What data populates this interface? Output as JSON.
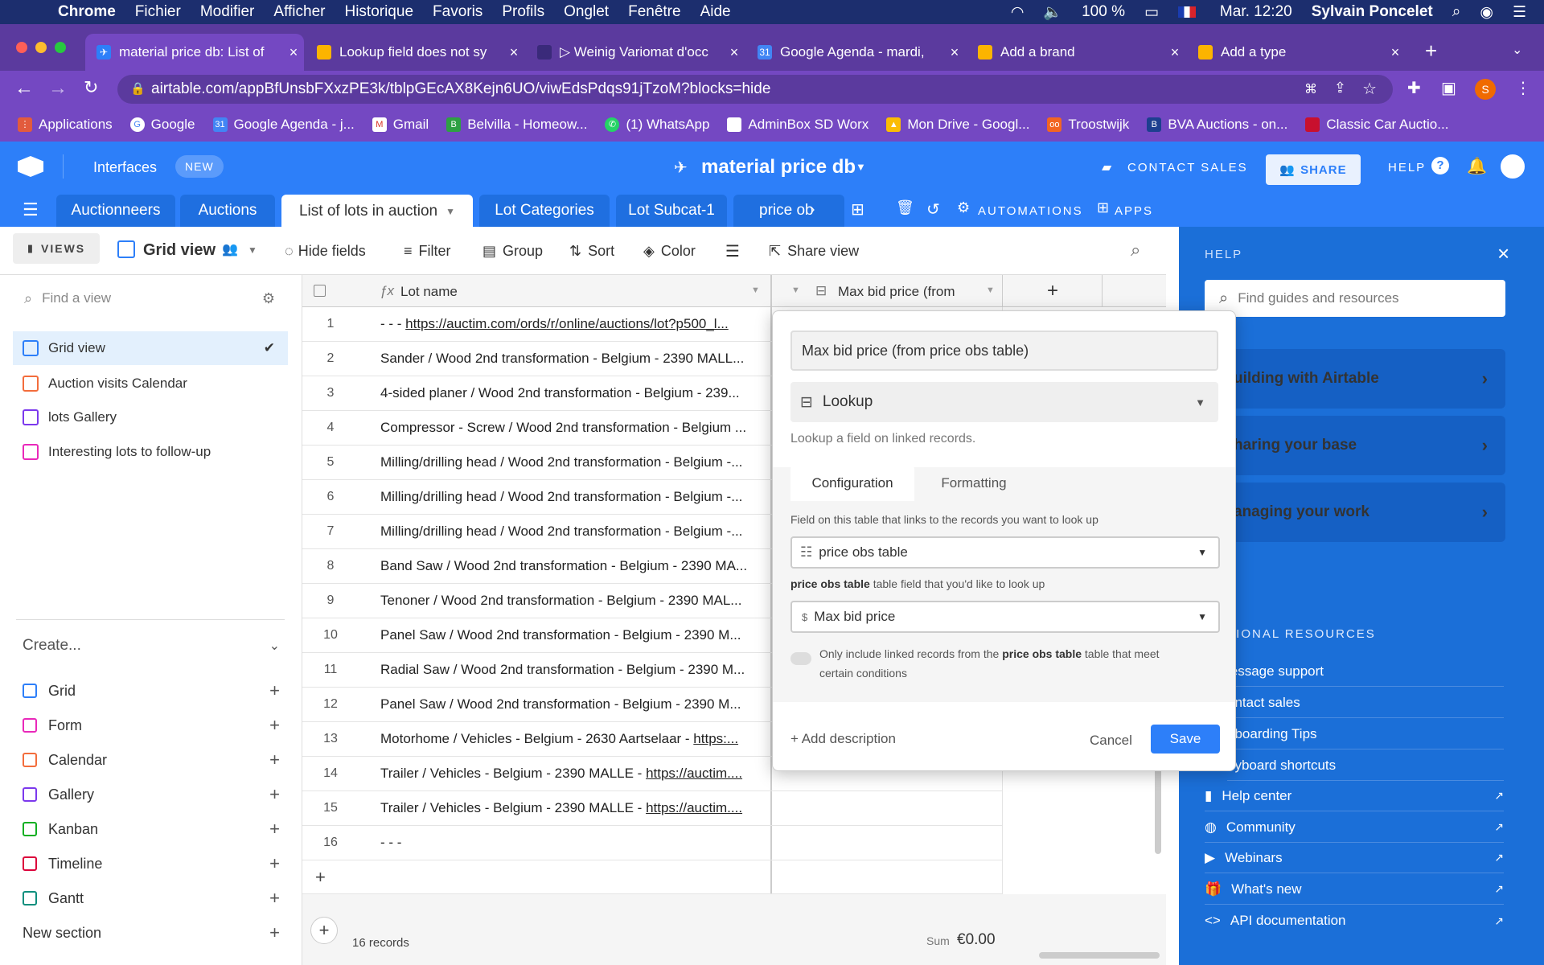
{
  "menubar": {
    "app": "Chrome",
    "items": [
      "Fichier",
      "Modifier",
      "Afficher",
      "Historique",
      "Favoris",
      "Profils",
      "Onglet",
      "Fenêtre",
      "Aide"
    ],
    "battery": "100 %",
    "datetime": "Mar. 12:20",
    "user": "Sylvain Poncelet"
  },
  "browser_tabs": [
    {
      "label": "material price db: List of",
      "active": true
    },
    {
      "label": "Lookup field does not sy"
    },
    {
      "label": "▷ Weinig Variomat d'occ"
    },
    {
      "label": "Google Agenda - mardi,"
    },
    {
      "label": "Add a brand"
    },
    {
      "label": "Add a type"
    }
  ],
  "url": "airtable.com/appBfUnsbFXxzPE3k/tblpGEcAX8Kejn6UO/viwEdsPdqs91jTzoM?blocks=hide",
  "bookmarks": [
    "Applications",
    "Google",
    "Google Agenda - j...",
    "Gmail",
    "Belvilla - Homeow...",
    "(1) WhatsApp",
    "AdminBox SD Worx",
    "Mon Drive - Googl...",
    "Troostwijk",
    "BVA Auctions - on...",
    "Classic Car Auctio..."
  ],
  "app_header": {
    "interfaces": "Interfaces",
    "new_badge": "NEW",
    "base_name": "material price db",
    "contact_sales": "CONTACT SALES",
    "share": "SHARE",
    "help": "HELP"
  },
  "table_tabs": [
    "Auctionneers",
    "Auctions",
    "List of lots in auction",
    "Lot Categories",
    "Lot Subcat-1",
    "price ob"
  ],
  "automations": "AUTOMATIONS",
  "apps": "APPS",
  "view_toolbar": {
    "views": "VIEWS",
    "view_name": "Grid view",
    "hide_fields": "Hide fields",
    "filter": "Filter",
    "group": "Group",
    "sort": "Sort",
    "color": "Color",
    "share_view": "Share view"
  },
  "sidebar": {
    "find_placeholder": "Find a view",
    "views": [
      "Grid view",
      "Auction visits Calendar",
      "lots Gallery",
      "Interesting lots to follow-up"
    ],
    "create": "Create...",
    "create_items": [
      "Grid",
      "Form",
      "Calendar",
      "Gallery",
      "Kanban",
      "Timeline",
      "Gantt"
    ],
    "new_section": "New section"
  },
  "grid": {
    "col_lot": "Lot name",
    "col_max": "Max bid price (from ...",
    "rows": [
      {
        "n": "1",
        "pre": "- - - ",
        "link": "https://auctim.com/ords/r/online/auctions/lot?p500_l..."
      },
      {
        "n": "2",
        "pre": "Sander / Wood 2nd transformation - Belgium - 2390 MALL...",
        "link": ""
      },
      {
        "n": "3",
        "pre": "4-sided planer / Wood 2nd transformation - Belgium - 239...",
        "link": ""
      },
      {
        "n": "4",
        "pre": "Compressor - Screw / Wood 2nd transformation - Belgium ...",
        "link": ""
      },
      {
        "n": "5",
        "pre": "Milling/drilling head / Wood 2nd transformation - Belgium -...",
        "link": ""
      },
      {
        "n": "6",
        "pre": "Milling/drilling head / Wood 2nd transformation - Belgium -...",
        "link": ""
      },
      {
        "n": "7",
        "pre": "Milling/drilling head / Wood 2nd transformation - Belgium -...",
        "link": ""
      },
      {
        "n": "8",
        "pre": "Band Saw / Wood 2nd transformation - Belgium - 2390 MA...",
        "link": ""
      },
      {
        "n": "9",
        "pre": "Tenoner / Wood 2nd transformation - Belgium - 2390 MAL...",
        "link": ""
      },
      {
        "n": "10",
        "pre": "Panel Saw / Wood 2nd transformation - Belgium - 2390 M...",
        "link": ""
      },
      {
        "n": "11",
        "pre": "Radial Saw / Wood 2nd transformation - Belgium - 2390 M...",
        "link": ""
      },
      {
        "n": "12",
        "pre": "Panel Saw / Wood 2nd transformation - Belgium - 2390 M...",
        "link": ""
      },
      {
        "n": "13",
        "pre": "Motorhome / Vehicles - Belgium - 2630 Aartselaar - ",
        "link": "https:..."
      },
      {
        "n": "14",
        "pre": "Trailer / Vehicles - Belgium - 2390 MALLE - ",
        "link": "https://auctim...."
      },
      {
        "n": "15",
        "pre": "Trailer / Vehicles - Belgium - 2390 MALLE - ",
        "link": "https://auctim...."
      },
      {
        "n": "16",
        "pre": "- - -",
        "link": ""
      }
    ],
    "records": "16 records",
    "sum_label": "Sum",
    "sum_value": "€0.00"
  },
  "popup": {
    "field_name": "Max bid price (from price obs table)",
    "type": "Lookup",
    "type_desc": "Lookup a field on linked records.",
    "tab_config": "Configuration",
    "tab_format": "Formatting",
    "link_label": "Field on this table that links to the records you want to look up",
    "link_value": "price obs table",
    "lookup_label_bold": "price obs table",
    "lookup_label_rest": " table field that you'd like to look up",
    "lookup_value": "Max bid price",
    "cond_a": "Only include linked records from the ",
    "cond_bold": "price obs table",
    "cond_b": " table that meet",
    "cond_c": "certain conditions",
    "add_desc": "+ Add description",
    "cancel": "Cancel",
    "save": "Save"
  },
  "help_panel": {
    "title": "HELP",
    "search_placeholder": "Find guides and resources",
    "cards": [
      "uilding with Airtable",
      "haring your base",
      "anaging your work"
    ],
    "resources_title": "TIONAL RESOURCES",
    "plain_links": [
      "lessage support",
      "ontact sales",
      "nboarding Tips",
      "eyboard shortcuts"
    ],
    "ext_links": [
      "Help center",
      "Community",
      "Webinars",
      "What's new",
      "API documentation"
    ]
  }
}
